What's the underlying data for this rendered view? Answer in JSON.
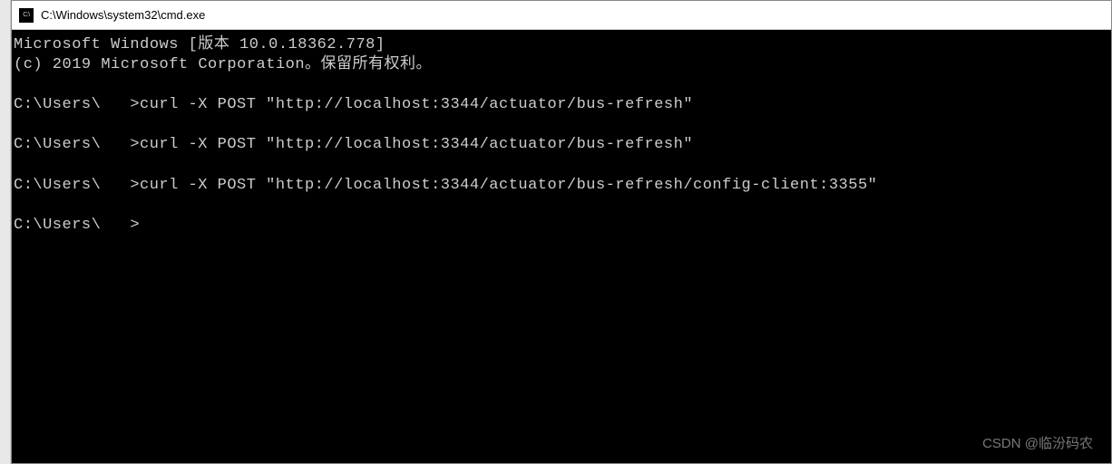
{
  "titlebar": {
    "icon_label": "C:\\",
    "title": "C:\\Windows\\system32\\cmd.exe"
  },
  "terminal": {
    "header_line1": "Microsoft Windows [版本 10.0.18362.778]",
    "header_line2": "(c) 2019 Microsoft Corporation。保留所有权利。",
    "prompt_prefix": "C:\\Users\\",
    "prompt_suffix": ">",
    "lines": [
      {
        "type": "header1"
      },
      {
        "type": "header2"
      },
      {
        "type": "blank"
      },
      {
        "type": "prompt",
        "cmd": "curl -X POST \"http://localhost:3344/actuator/bus-refresh\""
      },
      {
        "type": "blank"
      },
      {
        "type": "prompt",
        "cmd": "curl -X POST \"http://localhost:3344/actuator/bus-refresh\""
      },
      {
        "type": "blank"
      },
      {
        "type": "prompt",
        "cmd": "curl -X POST \"http://localhost:3344/actuator/bus-refresh/config-client:3355\""
      },
      {
        "type": "blank"
      },
      {
        "type": "prompt",
        "cmd": ""
      }
    ]
  },
  "watermark": "CSDN @临汾码农"
}
